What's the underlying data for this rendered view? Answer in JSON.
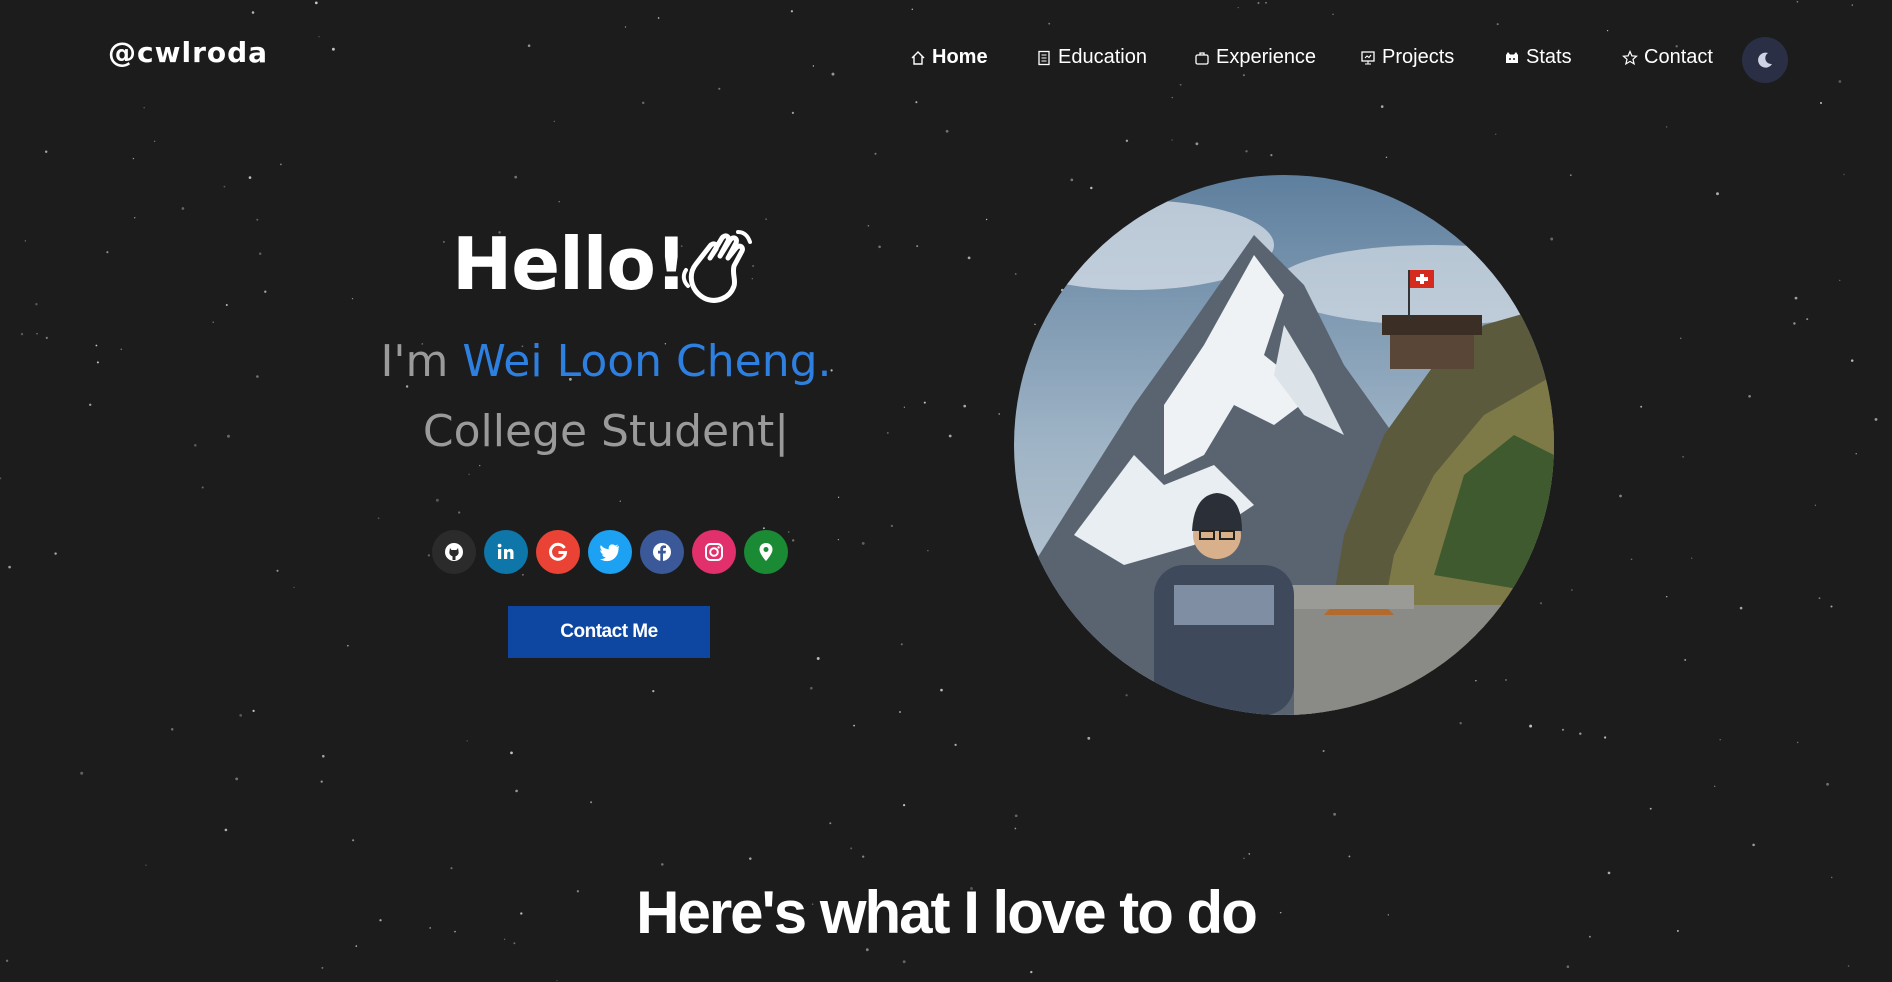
{
  "brand": {
    "handle": "@cwlroda"
  },
  "nav": {
    "items": [
      {
        "label": "Home",
        "icon": "home-icon",
        "active": true
      },
      {
        "label": "Education",
        "icon": "document-icon",
        "active": false
      },
      {
        "label": "Experience",
        "icon": "briefcase-icon",
        "active": false
      },
      {
        "label": "Projects",
        "icon": "presentation-icon",
        "active": false
      },
      {
        "label": "Stats",
        "icon": "github-cat-icon",
        "active": false
      },
      {
        "label": "Contact",
        "icon": "star-icon",
        "active": false
      }
    ],
    "theme_toggle_icon": "moon-icon"
  },
  "hero": {
    "greeting": "Hello!",
    "greeting_icon": "waving-hand-icon",
    "intro_prefix": "I'm ",
    "name": "Wei Loon Cheng.",
    "role": "College Student|",
    "cta_label": "Contact Me",
    "portrait_icon": "portrait-photo",
    "socials": [
      {
        "name": "github",
        "icon": "github-icon",
        "color": "#2b2b2b"
      },
      {
        "name": "linkedin",
        "icon": "linkedin-icon",
        "color": "#0e76a8"
      },
      {
        "name": "google",
        "icon": "google-icon",
        "color": "#ea4335"
      },
      {
        "name": "twitter",
        "icon": "twitter-icon",
        "color": "#1da1f2"
      },
      {
        "name": "facebook",
        "icon": "facebook-icon",
        "color": "#3b5998"
      },
      {
        "name": "instagram",
        "icon": "instagram-icon",
        "color": "#e1306c"
      },
      {
        "name": "location",
        "icon": "map-pin-icon",
        "color": "#1a8a34"
      }
    ]
  },
  "colors": {
    "background": "#1c1c1c",
    "accent": "#2d7fe0",
    "button": "#0d47a1",
    "muted_text": "#9a9a9a"
  },
  "section": {
    "title": "Here's what I love to do"
  }
}
